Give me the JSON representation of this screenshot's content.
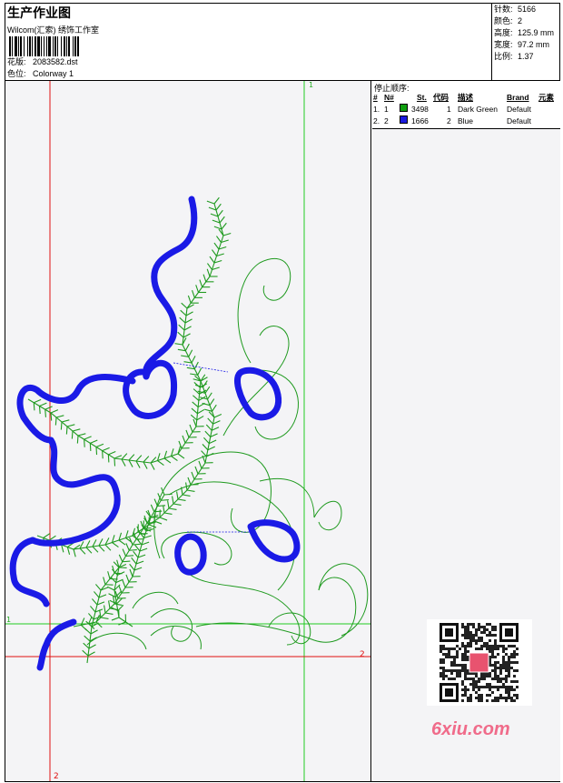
{
  "header": {
    "title": "生产作业图",
    "studio": "Wilcom(汇索) 绣饰工作室",
    "design_label": "花版:",
    "design_file": "2083582.dst",
    "colorway_label": "色位:",
    "colorway": "Colorway 1"
  },
  "stats": [
    {
      "label": "针数:",
      "value": "5166"
    },
    {
      "label": "颜色:",
      "value": "2"
    },
    {
      "label": "高度:",
      "value": "125.9 mm"
    },
    {
      "label": "宽度:",
      "value": "97.2 mm"
    },
    {
      "label": "比例:",
      "value": "1.37"
    }
  ],
  "stop_sequence": {
    "title": "停止顺序:",
    "headers": {
      "num": "#",
      "no": "N#",
      "st": "St.",
      "code": "代码",
      "desc": "描述",
      "brand": "Brand",
      "elem": "元素"
    },
    "rows": [
      {
        "num": "1.",
        "no": "1",
        "color": "#0f9e0f",
        "st": "3498",
        "code": "1",
        "desc": "Dark Green",
        "brand": "Default"
      },
      {
        "num": "2.",
        "no": "2",
        "color": "#1a1adf",
        "st": "1666",
        "code": "2",
        "desc": "Blue",
        "brand": "Default"
      }
    ]
  },
  "guides": {
    "v1_label": "1",
    "h1_label": "1",
    "h2_label": "2",
    "v2_label": "2"
  },
  "colors": {
    "green": "#1f9a1f",
    "blue": "#1a1ae6",
    "guide_green": "#22cc22",
    "guide_red": "#e01010"
  },
  "watermark": "6xiu.com"
}
